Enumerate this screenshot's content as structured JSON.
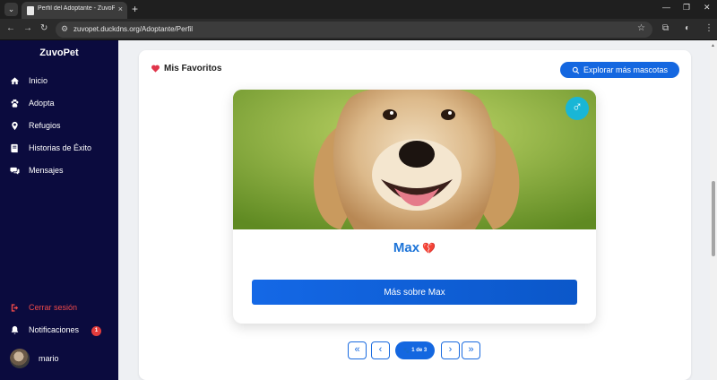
{
  "browser": {
    "tab_title": "Perfil del Adoptante - ZuvoPet",
    "tab_close": "×",
    "new_tab": "+",
    "url": "zuvopet.duckdns.org/Adoptante/Perfil",
    "minimize": "—",
    "restore": "❐",
    "close": "✕",
    "back": "←",
    "forward": "→",
    "reload": "↻",
    "star": "☆",
    "menu": "⋮",
    "tab_menu": "⌄"
  },
  "sidebar": {
    "brand": "ZuvoPet",
    "items": [
      {
        "label": "Inicio",
        "icon": "home-icon"
      },
      {
        "label": "Adopta",
        "icon": "paw-icon"
      },
      {
        "label": "Refugios",
        "icon": "location-pin-icon"
      },
      {
        "label": "Historias de Éxito",
        "icon": "book-icon"
      },
      {
        "label": "Mensajes",
        "icon": "chat-bubbles-icon"
      }
    ],
    "logout": "Cerrar sesión",
    "notifications": "Notificaciones",
    "notification_count": "1",
    "username": "mario"
  },
  "favorites": {
    "title": "Mis Favoritos",
    "explore_button": "Explorar más mascotas",
    "pet_name": "Max",
    "heart_symbol": "💔",
    "gender_symbol": "♂",
    "more_button": "Más sobre Max",
    "pagination": {
      "first": "«",
      "prev": "‹",
      "indicator": "1 de 3",
      "next": "›",
      "last": "»"
    }
  },
  "colors": {
    "sidebar_bg": "#0b0b3e",
    "accent": "#1467e0",
    "danger": "#ef4a4a",
    "gender_badge": "#19b6d6"
  }
}
